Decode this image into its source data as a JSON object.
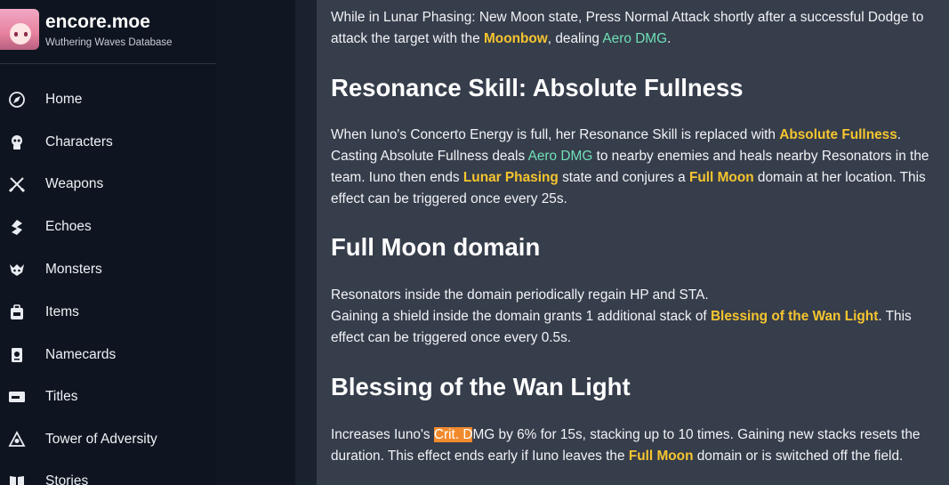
{
  "brand": {
    "title": "encore.moe",
    "subtitle": "Wuthering Waves Database"
  },
  "nav": [
    {
      "label": "Home",
      "icon": "compass-icon"
    },
    {
      "label": "Characters",
      "icon": "character-icon"
    },
    {
      "label": "Weapons",
      "icon": "crossed-swords-icon"
    },
    {
      "label": "Echoes",
      "icon": "echo-icon"
    },
    {
      "label": "Monsters",
      "icon": "monster-icon"
    },
    {
      "label": "Items",
      "icon": "backpack-icon"
    },
    {
      "label": "Namecards",
      "icon": "namecard-icon"
    },
    {
      "label": "Titles",
      "icon": "title-card-icon"
    },
    {
      "label": "Tower of Adversity",
      "icon": "tower-icon"
    },
    {
      "label": "Stories",
      "icon": "book-icon"
    }
  ],
  "content": {
    "intro": {
      "t1": "While in Lunar Phasing: New Moon state, Press Normal Attack shortly after a successful Dodge to attack the target with the ",
      "moonbow": "Moonbow",
      "t2": ", dealing ",
      "aero": "Aero DMG",
      "t3": "."
    },
    "h_resonance": "Resonance Skill: Absolute Fullness",
    "resonance": {
      "t1": "When Iuno's Concerto Energy is full, her Resonance Skill is replaced with ",
      "absolute": "Absolute Fullness",
      "t2": ". Casting Absolute Fullness deals ",
      "aero": "Aero DMG",
      "t3": " to nearby enemies and heals nearby Resonators in the team. Iuno then ends ",
      "lunar": "Lunar Phasing",
      "t4": " state and conjures a ",
      "fullmoon": "Full Moon",
      "t5": " domain at her location. This effect can be triggered once every 25s."
    },
    "h_fullmoon": "Full Moon domain",
    "fullmoon": {
      "line1": "Resonators inside the domain periodically regain HP and STA.",
      "t1": "Gaining a shield inside the domain grants 1 additional stack of ",
      "blessing": "Blessing of the Wan Light",
      "t2": ". This effect can be triggered once every 0.5s."
    },
    "h_blessing": "Blessing of the Wan Light",
    "blessing": {
      "t1": "Increases Iuno's ",
      "hl": "Crit. D",
      "t2": "MG by 6% for 15s, stacking up to 10 times. Gaining new stacks resets the duration. This effect ends early if Iuno leaves the ",
      "fullmoon": "Full Moon",
      "t3": " domain or is switched off the field."
    }
  }
}
